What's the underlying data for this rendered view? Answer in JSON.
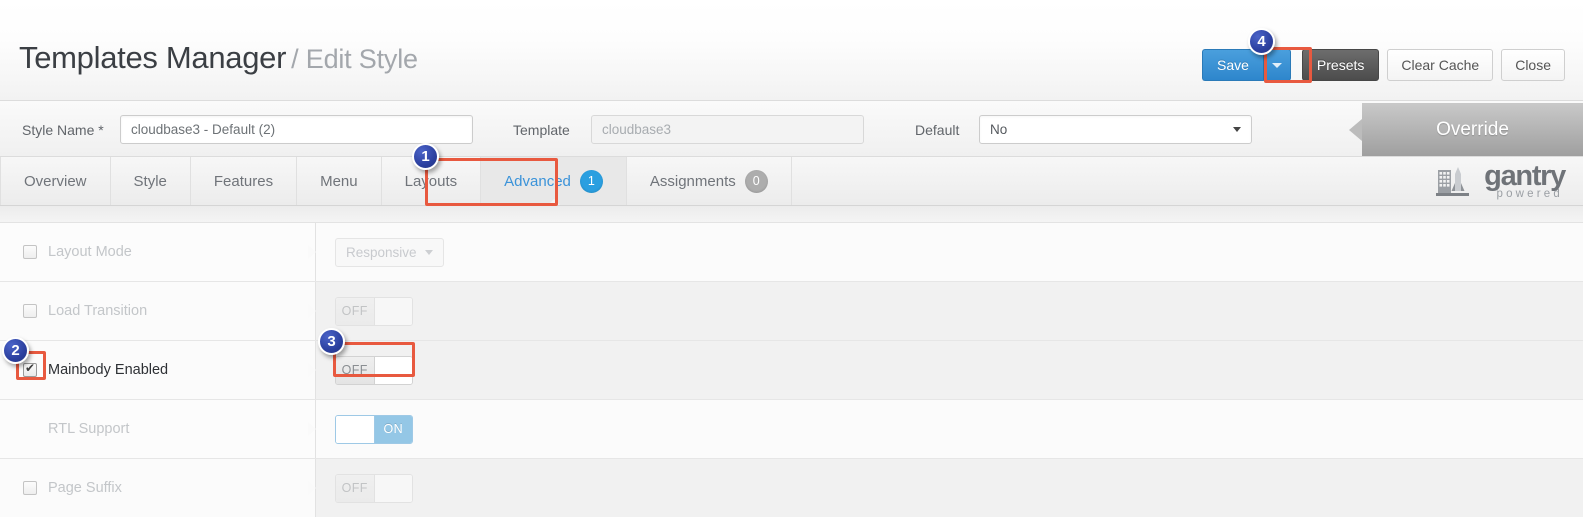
{
  "header": {
    "title_main": "Templates Manager",
    "title_sub": "/ Edit Style",
    "buttons": {
      "save": "Save",
      "save_caret_icon": "chevron-down-icon",
      "presets": "Presets",
      "clear_cache": "Clear Cache",
      "close": "Close"
    }
  },
  "formbar": {
    "style_name_label": "Style Name *",
    "style_name_value": "cloudbase3 - Default (2)",
    "template_label": "Template",
    "template_value": "cloudbase3",
    "default_label": "Default",
    "default_value": "No",
    "override_label": "Override"
  },
  "tabs": [
    {
      "label": "Overview",
      "badge": null,
      "active": false
    },
    {
      "label": "Style",
      "badge": null,
      "active": false
    },
    {
      "label": "Features",
      "badge": null,
      "active": false
    },
    {
      "label": "Menu",
      "badge": null,
      "active": false
    },
    {
      "label": "Layouts",
      "badge": null,
      "active": false
    },
    {
      "label": "Advanced",
      "badge": "1",
      "active": true
    },
    {
      "label": "Assignments",
      "badge": "0",
      "active": false
    }
  ],
  "branding": {
    "name": "gantry",
    "tagline": "powered",
    "logo_icon": "gantry-rocket-icon"
  },
  "settings_rows": [
    {
      "label": "Layout Mode",
      "has_checkbox": true,
      "checked": false,
      "enabled": false,
      "control_type": "select",
      "control_value": "Responsive"
    },
    {
      "label": "Load Transition",
      "has_checkbox": true,
      "checked": false,
      "enabled": false,
      "control_type": "toggle",
      "control_value": "OFF"
    },
    {
      "label": "Mainbody Enabled",
      "has_checkbox": true,
      "checked": true,
      "enabled": true,
      "control_type": "toggle",
      "control_value": "OFF"
    },
    {
      "label": "RTL Support",
      "has_checkbox": false,
      "checked": false,
      "enabled": false,
      "control_type": "toggle",
      "control_value": "ON"
    },
    {
      "label": "Page Suffix",
      "has_checkbox": true,
      "checked": false,
      "enabled": false,
      "control_type": "toggle",
      "control_value": "OFF"
    }
  ],
  "toggle_labels": {
    "off": "OFF",
    "on": "ON"
  },
  "annotations": [
    {
      "number": "1",
      "target": "advanced-tab"
    },
    {
      "number": "2",
      "target": "mainbody-enabled-checkbox"
    },
    {
      "number": "3",
      "target": "mainbody-enabled-toggle"
    },
    {
      "number": "4",
      "target": "save-button"
    }
  ],
  "colors": {
    "accent_blue": "#2e86cc",
    "tab_active_blue": "#3b93d9",
    "badge_blue": "#2a9fe0",
    "highlight_red": "#e8593f",
    "annotation_blue": "#2b3f9e",
    "toggle_on_blue": "#94c7e6"
  }
}
